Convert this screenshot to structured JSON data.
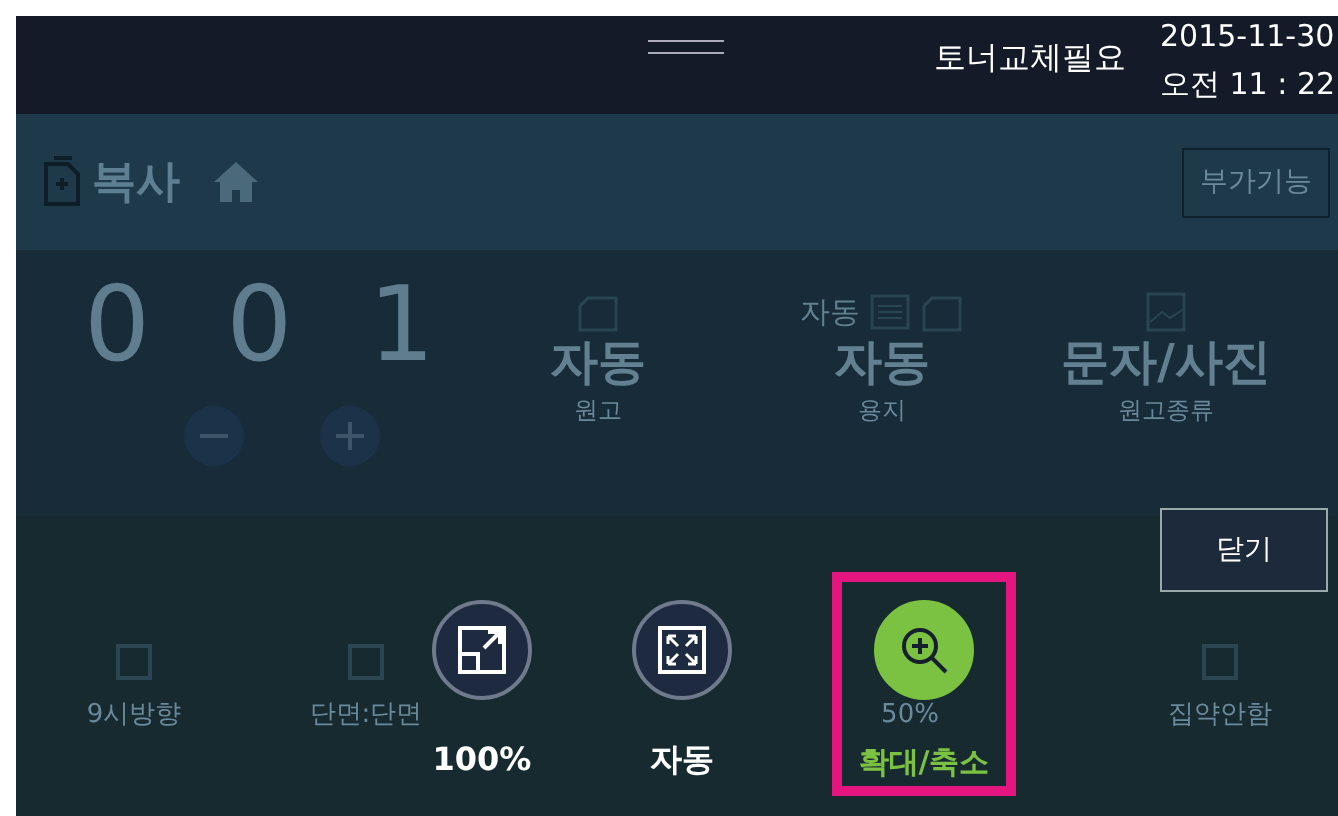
{
  "status_bar": {
    "toner_message": "토너교체필요",
    "date": "2015-11-30",
    "time": "오전 11 : 22"
  },
  "header": {
    "title": "복사",
    "extra_button": "부가기능"
  },
  "copies": {
    "digits": [
      "0",
      "0",
      "1"
    ]
  },
  "settings": [
    {
      "value": "자동",
      "label": "원고"
    },
    {
      "top_label": "자동",
      "value": "자동",
      "label": "용지"
    },
    {
      "value": "문자/사진",
      "label": "원고종류"
    }
  ],
  "close_button": "닫기",
  "bottom_options": [
    {
      "label": "9시방향"
    },
    {
      "label": "단면:단면"
    },
    {
      "label": "50%"
    },
    {
      "label": "집약안함"
    }
  ],
  "zoom_options": [
    {
      "kind": "original",
      "label": "100%",
      "selected": false
    },
    {
      "kind": "auto",
      "label": "자동",
      "selected": false
    },
    {
      "kind": "custom",
      "label": "확대/축소",
      "selected": true
    }
  ]
}
